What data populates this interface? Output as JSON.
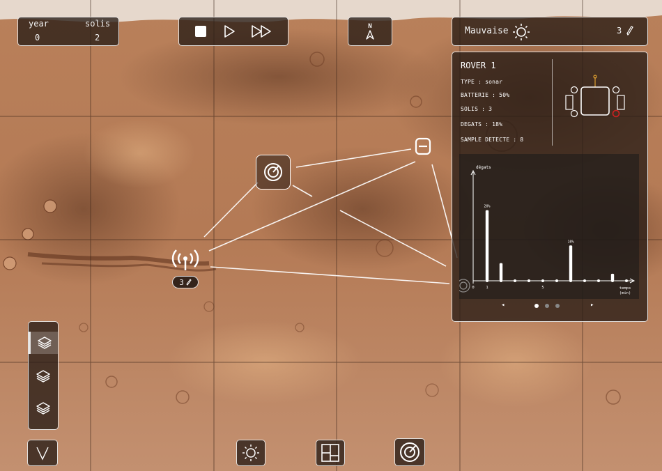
{
  "time": {
    "year_label": "year",
    "year_value": "0",
    "solis_label": "solis",
    "solis_value": "2"
  },
  "playback": {
    "icons": [
      "stop-icon",
      "play-icon",
      "fast-forward-icon"
    ]
  },
  "compass": {
    "icon": "north-arrow-icon",
    "letter": "N"
  },
  "weather": {
    "label": "Mauvaise",
    "icon": "sun-icon",
    "count": "3"
  },
  "rover": {
    "title": "ROVER 1",
    "type": "TYPE : sonar",
    "battery": "BATTERIE : 50%",
    "solis": "SOLIS : 3",
    "damage": "DEGATS : 18%",
    "samples": "SAMPLE DETECTE : 8"
  },
  "chart_data": {
    "type": "bar",
    "ylabel": "dégats",
    "xlabel": "temps (min)",
    "x_ticks": [
      "0",
      "1",
      "5"
    ],
    "series": [
      {
        "values": [
          {
            "x": 1,
            "y": 20
          },
          {
            "x": 2,
            "y": 5
          },
          {
            "x": 7,
            "y": 10
          },
          {
            "x": 10,
            "y": 2
          }
        ]
      }
    ],
    "data_labels": [
      {
        "x": 1,
        "text": "20%"
      },
      {
        "x": 7,
        "text": "10%"
      }
    ],
    "dot_count": 11,
    "x_range": [
      0,
      11
    ],
    "y_range": [
      0,
      28
    ]
  },
  "pager": {
    "prev": "◂",
    "next": "▸",
    "pages": 3,
    "active": 0
  },
  "station": {
    "count": "3"
  },
  "left_toolbar": {
    "icons": [
      "layers-icon",
      "layers-icon",
      "layers-icon"
    ],
    "collapse_icon": "chevron-down-icon"
  },
  "bottom_toolbar": {
    "icons": [
      "sun-icon",
      "grid-icon",
      "sonar-icon"
    ]
  },
  "colors": {
    "panel": "#2a1c16",
    "accent": "#e0a030",
    "alert": "#d02020"
  }
}
